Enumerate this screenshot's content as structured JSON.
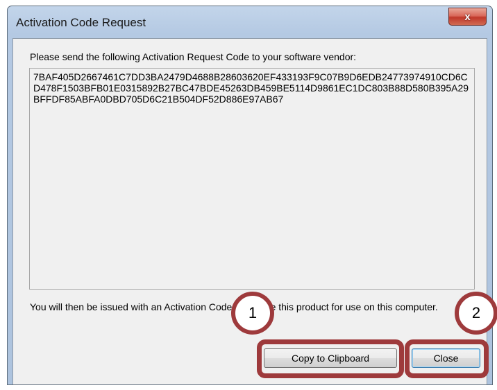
{
  "window": {
    "title": "Activation Code Request",
    "close_glyph": "x"
  },
  "dialog": {
    "intro": "Please send the following Activation Request Code to your software vendor:",
    "request_code": "7BAF405D2667461C7DD3BA2479D4688B28603620EF433193F9C07B9D6EDB24773974910CD6CD478F1503BFB01E0315892B27BC47BDE45263DB459BE5114D9861EC1DC803B88D580B395A29BFFDF85ABFA0DBD705D6C21B504DF52D886E97AB67",
    "note": "You will then be issued with an Activation Code to license this product for use on this computer."
  },
  "buttons": {
    "copy_label": "Copy to Clipboard",
    "close_label": "Close"
  },
  "callouts": {
    "first": "1",
    "second": "2"
  },
  "colors": {
    "highlight": "#9e3a3c",
    "title_close": "#c0382a"
  }
}
